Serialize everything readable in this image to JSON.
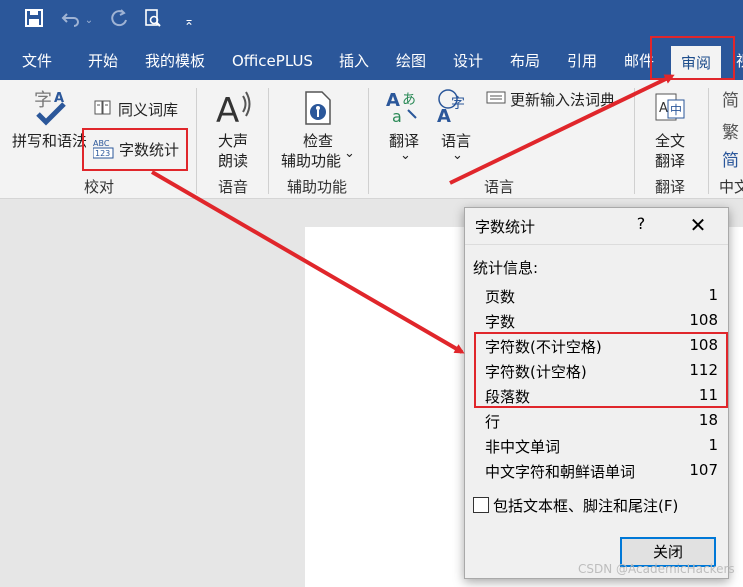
{
  "quick_access": {
    "save_icon": "save-icon",
    "undo_icon": "undo-icon",
    "redo_icon": "redo-icon",
    "preview_icon": "print-preview-icon",
    "customize_icon": "customize-icon"
  },
  "tabs": [
    "文件",
    "开始",
    "我的模板",
    "OfficePLUS",
    "插入",
    "绘图",
    "设计",
    "布局",
    "引用",
    "邮件",
    "审阅",
    "视"
  ],
  "active_tab": "审阅",
  "ribbon": {
    "proofing": {
      "spelling": "拼写和语法",
      "thesaurus": "同义词库",
      "word_count": "字数统计",
      "group": "校对"
    },
    "speech": {
      "read_aloud_1": "大声",
      "read_aloud_2": "朗读",
      "group": "语音"
    },
    "accessibility": {
      "check_1": "检查",
      "check_2": "辅助功能",
      "chevron": "⌄",
      "group": "辅助功能"
    },
    "language": {
      "translate": "翻译",
      "language": "语言",
      "update_ime": "更新输入法词典",
      "group": "语言"
    },
    "translation": {
      "full_1": "全文",
      "full_2": "翻译",
      "group": "翻译"
    },
    "chinese": {
      "c1": "简",
      "c2": "繁",
      "c3": "简",
      "group": "中文"
    }
  },
  "dialog": {
    "title": "字数统计",
    "help": "?",
    "close_x": "✕",
    "stats_header": "统计信息:",
    "rows": [
      {
        "label": "页数",
        "value": "1"
      },
      {
        "label": "字数",
        "value": "108"
      },
      {
        "label": "字符数(不计空格)",
        "value": "108"
      },
      {
        "label": "字符数(计空格)",
        "value": "112"
      },
      {
        "label": "段落数",
        "value": "11"
      },
      {
        "label": "行",
        "value": "18"
      },
      {
        "label": "非中文单词",
        "value": "1"
      },
      {
        "label": "中文字符和朝鲜语单词",
        "value": "107"
      }
    ],
    "checkbox_label": "包括文本框、脚注和尾注(F)",
    "close_button": "关闭"
  },
  "colors": {
    "accent": "#2b579a",
    "highlight": "#e0262b"
  },
  "watermark": "CSDN @AcademicHackers"
}
